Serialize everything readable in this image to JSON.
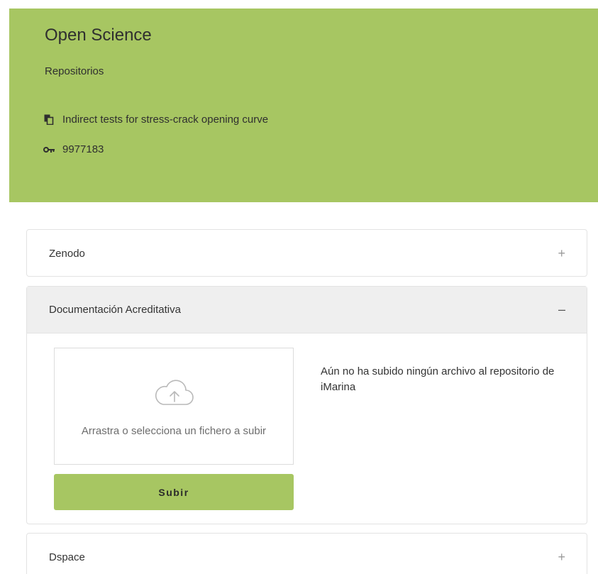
{
  "header": {
    "title": "Open Science",
    "subtitle": "Repositorios",
    "item_title": "Indirect tests for stress-crack opening curve",
    "item_id": "9977183",
    "colors": {
      "accent": "#a7c662"
    }
  },
  "panels": {
    "zenodo": {
      "label": "Zenodo",
      "toggle": "+"
    },
    "documentation": {
      "label": "Documentación Acreditativa",
      "toggle": "–",
      "dropzone_text": "Arrastra o selecciona un fichero a subir",
      "upload_label": "Subir",
      "empty_message": "Aún no ha subido ningún archivo al repositorio de iMarina"
    },
    "dspace": {
      "label": "Dspace",
      "toggle": "+"
    }
  },
  "icons": {
    "item": "document-copy-icon",
    "id": "key-icon",
    "upload": "cloud-upload-icon"
  }
}
